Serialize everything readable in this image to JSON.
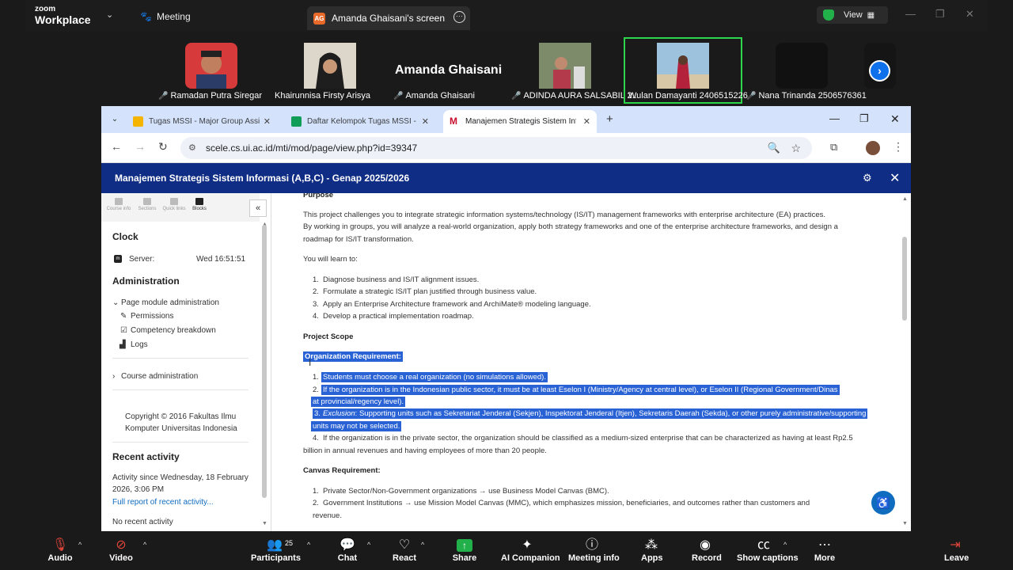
{
  "zoom": {
    "brand_small": "zoom",
    "brand_big": "Workplace",
    "meeting_label": "Meeting",
    "share_initials": "AG",
    "share_title": "Amanda Ghaisani's screen",
    "view_label": "View",
    "participants": [
      {
        "name": "Ramadan Putra Siregar",
        "muted": true
      },
      {
        "name": "Khairunnisa Firsty Arisya",
        "muted": false
      },
      {
        "name": "Amanda Ghaisani",
        "muted": true,
        "display": "Amanda Ghaisani"
      },
      {
        "name": "ADINDA AURA SALSABIL 2...",
        "muted": true
      },
      {
        "name": "Wulan Damayanti 2406515226",
        "muted": false
      },
      {
        "name": "Nana Trinanda 2506576361",
        "muted": true
      }
    ],
    "toolbar": {
      "audio": "Audio",
      "video": "Video",
      "participants": "Participants",
      "participants_count": "25",
      "chat": "Chat",
      "react": "React",
      "share": "Share",
      "ai": "AI Companion",
      "info": "Meeting info",
      "apps": "Apps",
      "record": "Record",
      "captions": "Show captions",
      "more": "More",
      "leave": "Leave"
    }
  },
  "browser": {
    "tabs": [
      {
        "title": "Tugas MSSI - Major Group Assignment",
        "favicon_color": "#f4b400"
      },
      {
        "title": "Daftar Kelompok Tugas MSSI - Google Sheets",
        "favicon_color": "#0f9d58"
      },
      {
        "title": "Manajemen Strategis Sistem Informasi",
        "favicon_color": "#c8102e"
      }
    ],
    "url": "scele.cs.ui.ac.id/mti/mod/page/view.php?id=39347"
  },
  "moodle": {
    "course_title": "Manajemen Strategis Sistem Informasi (A,B,C) - Genap 2025/2026",
    "drawer_tabs": [
      "Course info",
      "Sections",
      "Quick links",
      "Blocks"
    ],
    "clock_heading": "Clock",
    "server_label": "Server:",
    "server_time": "Wed 16:51:51",
    "admin_heading": "Administration",
    "admin_items": [
      "Page module administration",
      "Permissions",
      "Competency breakdown",
      "Logs"
    ],
    "course_admin": "Course administration",
    "copyright": [
      "Copyright © 2016 Fakultas Ilmu",
      "Komputer Universitas Indonesia"
    ],
    "recent_heading": "Recent activity",
    "recent_since": [
      "Activity since Wednesday, 18 February",
      "2026, 3:06 PM"
    ],
    "recent_link": "Full report of recent activity...",
    "recent_none": "No recent activity"
  },
  "content": {
    "purpose_heading": "Purpose",
    "intro": [
      "This project challenges you to integrate strategic information systems/technology (IS/IT) management frameworks with enterprise architecture (EA) practices.",
      "By working in groups, you will analyze a real-world organization, apply both strategy frameworks and one of the enterprise architecture frameworks, and design a",
      "roadmap for IS/IT transformation."
    ],
    "learn_label": "You will learn to:",
    "learn": [
      "Diagnose business and IS/IT alignment issues.",
      "Formulate a strategic IS/IT plan justified through business value.",
      "Apply an Enterprise Architecture framework and ArchiMate® modeling language.",
      "Develop a practical implementation roadmap."
    ],
    "scope_heading": "Project Scope",
    "org_heading": "Organization Requirement:",
    "org1": "Students must choose a real organization (no simulations allowed).",
    "org2a": "If the organization is in the Indonesian public sector, it must be at least Eselon I (Ministry/Agency at central level), or Eselon II (Regional Government/Dinas",
    "org2b": "at provincial/regency level).",
    "org3_em": "Exclusion",
    "org3a": ": Supporting units such as Sekretariat Jenderal (Sekjen), Inspektorat Jenderal (Itjen), Sekretaris Daerah (Sekda), or other purely administrative/supporting",
    "org3b": "units may not be selected.",
    "org4a": "If the organization is in the private sector, the organization should be classified as a medium-sized enterprise that can be characterized as having at least Rp2.5",
    "org4b": "billion in annual revenues and having employees of more than 20 people.",
    "canvas_heading": "Canvas Requirement:",
    "canvas1": "Private Sector/Non-Government organizations → use Business Model Canvas (BMC).",
    "canvas2a": "Government Institutions → use Mission Model Canvas (MMC), which emphasizes mission, beneficiaries, and outcomes rather than customers and",
    "canvas2b": "revenue."
  }
}
